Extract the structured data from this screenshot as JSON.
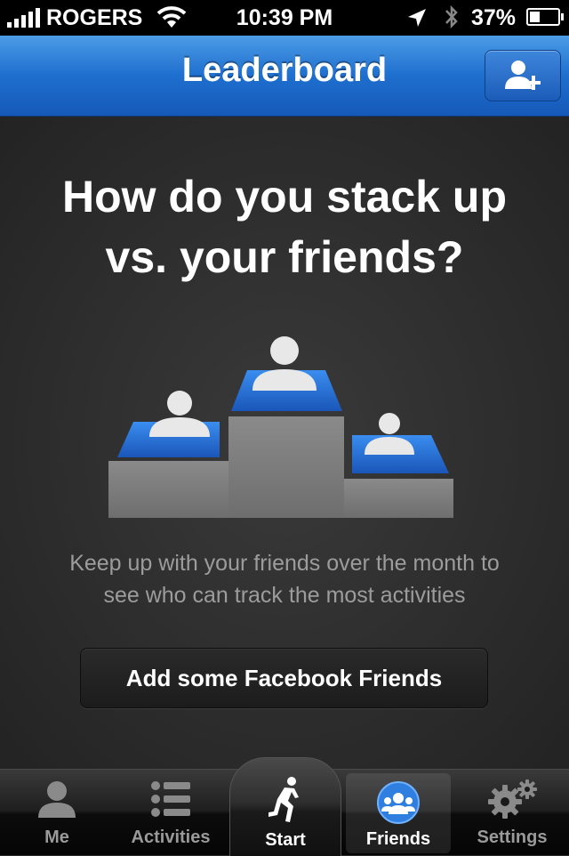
{
  "status_bar": {
    "carrier": "ROGERS",
    "time": "10:39 PM",
    "battery_percent": "37%",
    "battery_level": 0.37
  },
  "nav": {
    "title": "Leaderboard",
    "add_friend_icon": "add-person-icon"
  },
  "main": {
    "headline_line1": "How do you stack up",
    "headline_line2": "vs. your friends?",
    "description_line1": "Keep up with your friends over the month to",
    "description_line2": "see who can track the most activities",
    "button_label": "Add some Facebook Friends"
  },
  "tabs": [
    {
      "label": "Me",
      "icon": "person-icon"
    },
    {
      "label": "Activities",
      "icon": "list-icon"
    },
    {
      "label": "Start",
      "icon": "runner-icon"
    },
    {
      "label": "Friends",
      "icon": "friends-icon",
      "selected": true
    },
    {
      "label": "Settings",
      "icon": "gears-icon"
    }
  ],
  "colors": {
    "nav_blue": "#1e6fcf",
    "accent_blue": "#2f7fe0",
    "background": "#2e2e2e",
    "description_text": "#9c9c9c"
  }
}
